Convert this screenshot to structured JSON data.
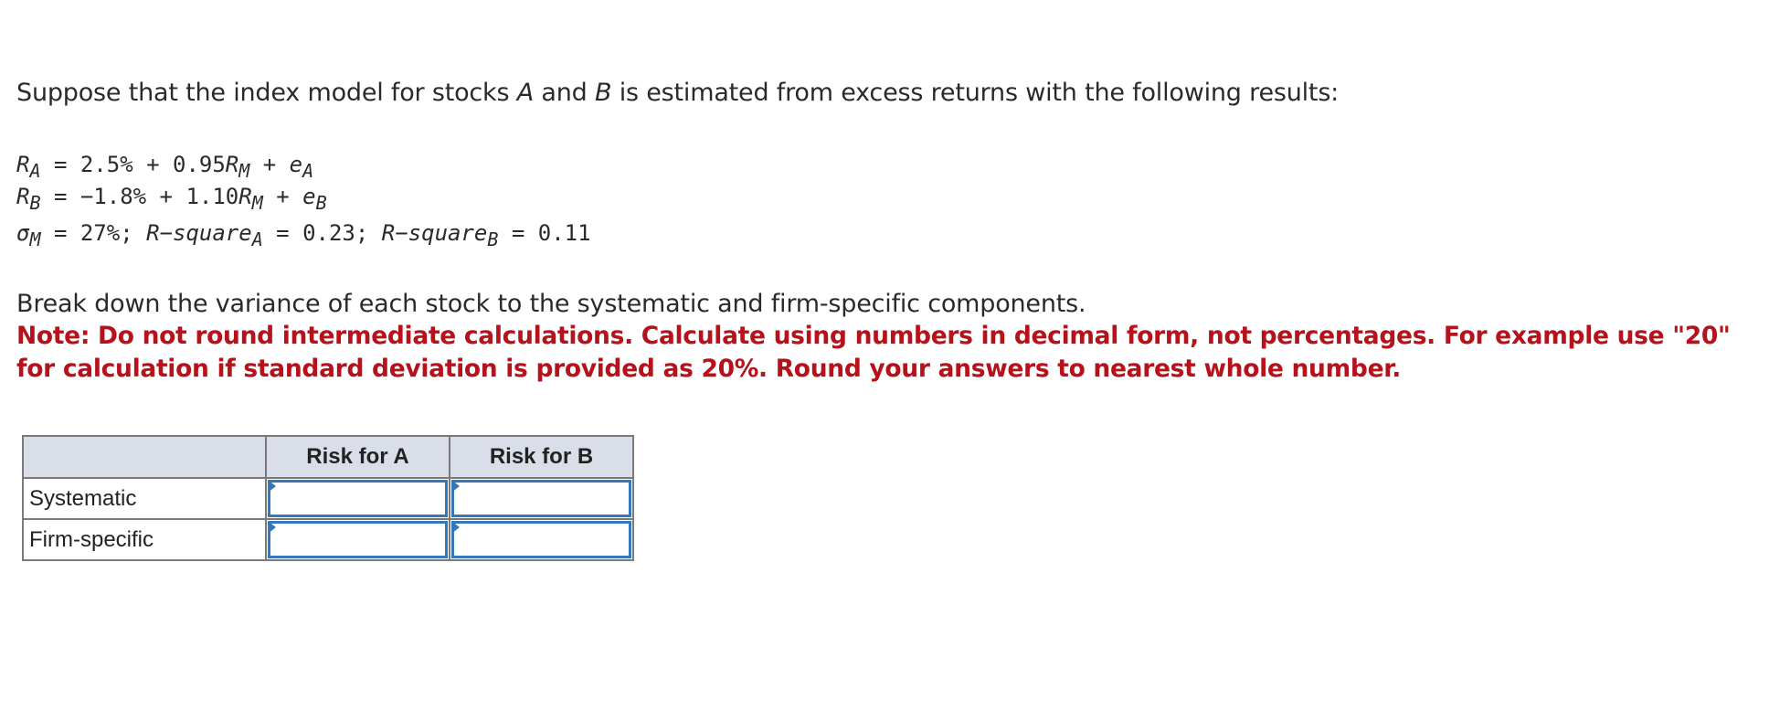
{
  "intro": {
    "prefix": "Suppose that the index model for stocks ",
    "stock_a": "A",
    "middle": " and ",
    "stock_b": "B",
    "suffix": " is estimated from excess returns with the following results:"
  },
  "equations": {
    "eq1": {
      "lhs": "R",
      "lhs_sub": "A",
      "text1": " = 2.5% + 0.95",
      "var": "R",
      "var_sub": "M",
      "text2": " + ",
      "err": "e",
      "err_sub": "A"
    },
    "eq2": {
      "lhs": "R",
      "lhs_sub": "B",
      "text1": " = −1.8% + 1.10",
      "var": "R",
      "var_sub": "M",
      "text2": " + ",
      "err": "e",
      "err_sub": "B"
    },
    "eq3": {
      "sigma": "σ",
      "sigma_sub": "M",
      "text1": " = 27%; ",
      "rsq_a": "R−square",
      "rsq_a_sub": "A",
      "text2": " = 0.23; ",
      "rsq_b": "R−square",
      "rsq_b_sub": "B",
      "text3": " = 0.11"
    }
  },
  "instruction": "Break down the variance of each stock to the systematic and firm-specific components.",
  "note": "Note: Do not round intermediate calculations. Calculate using numbers in decimal form, not percentages. For example use \"20\" for calculation if standard deviation is provided as 20%. Round your answers to nearest whole number.",
  "colors": {
    "note": "#b5121b",
    "input_border": "#3578b8",
    "header_bg": "#d9dee8"
  },
  "table": {
    "headers": [
      "",
      "Risk for A",
      "Risk for B"
    ],
    "rows": [
      {
        "label": "Systematic",
        "risk_a": "",
        "risk_b": ""
      },
      {
        "label": "Firm-specific",
        "risk_a": "",
        "risk_b": ""
      }
    ]
  }
}
